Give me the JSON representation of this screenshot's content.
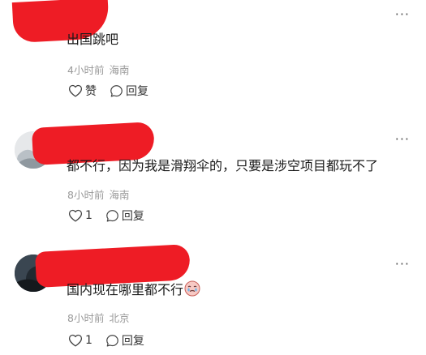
{
  "comments": [
    {
      "text": "出国跳吧",
      "time": "4小时前",
      "location": "海南",
      "like_label": "赞",
      "reply_label": "回复",
      "more_icon": "more-dots-icon"
    },
    {
      "text": "都不行，因为我是滑翔伞的，只要是涉空项目都玩不了",
      "time": "8小时前",
      "location": "海南",
      "like_label": "1",
      "reply_label": "回复",
      "more_icon": "more-dots-icon"
    },
    {
      "text": "国内现在哪里都不行",
      "emoji": "crying-face-emoji",
      "time": "8小时前",
      "location": "北京",
      "like_label": "1",
      "reply_label": "回复",
      "more_icon": "more-dots-icon"
    }
  ],
  "colors": {
    "redaction": "#ee1c25",
    "meta_text": "#999999",
    "body_text": "#1a1a1a"
  }
}
